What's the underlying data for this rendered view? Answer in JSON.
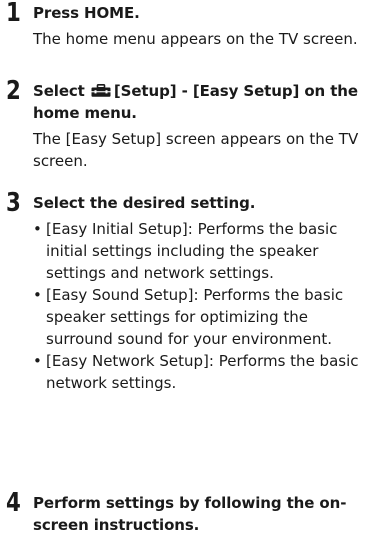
{
  "steps": [
    {
      "number": "1",
      "title": "Press HOME.",
      "description": "The home menu appears on the TV screen."
    },
    {
      "number": "2",
      "title_prefix": "Select",
      "icon": "toolbox-icon",
      "title_rest": "[Setup] - [Easy Setup] on the home menu.",
      "description": "The [Easy Setup] screen appears on the TV screen."
    },
    {
      "number": "3",
      "title": "Select the desired setting.",
      "bullet_char": "•",
      "bullets": [
        "[Easy Initial Setup]: Performs the basic initial settings including the speaker settings and network settings.",
        "[Easy Sound Setup]: Performs the basic speaker settings for optimizing the surround sound for your environment.",
        "[Easy Network Setup]: Performs the basic network settings."
      ]
    },
    {
      "number": "4",
      "title": "Perform settings by following the on-screen instructions."
    }
  ]
}
